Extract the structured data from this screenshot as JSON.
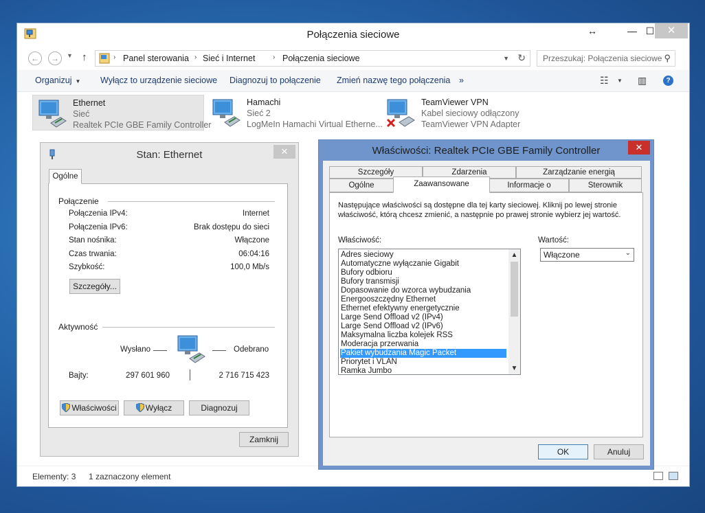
{
  "window": {
    "title": "Połączenia sieciowe",
    "caption": {
      "restore": "↔",
      "minimize": "—",
      "maximize": "☐",
      "close": "✕"
    }
  },
  "address": {
    "back_icon": "back-arrow-icon",
    "breadcrumbs": [
      "Panel sterowania",
      "Sieć i Internet",
      "Połączenia sieciowe"
    ],
    "search_placeholder": "Przeszukaj: Połączenia sieciowe"
  },
  "toolbar": {
    "organize": "Organizuj",
    "disable": "Wyłącz to urządzenie sieciowe",
    "diagnose": "Diagnozuj to połączenie",
    "rename": "Zmień nazwę tego połączenia",
    "more": "»"
  },
  "connections": [
    {
      "name": "Ethernet",
      "status": "Sieć",
      "device": "Realtek PCIe GBE Family Controller",
      "selected": true
    },
    {
      "name": "Hamachi",
      "status": "Sieć  2",
      "device": "LogMeIn Hamachi Virtual Etherne...",
      "selected": false
    },
    {
      "name": "TeamViewer VPN",
      "status": "Kabel sieciowy odłączony",
      "device": "TeamViewer VPN Adapter",
      "selected": false,
      "disconnected": true
    }
  ],
  "statusbar": {
    "count": "Elementy: 3",
    "selected": "1 zaznaczony element"
  },
  "status_dialog": {
    "title": "Stan: Ethernet",
    "tab": "Ogólne",
    "connection_group": "Połączenie",
    "rows": [
      {
        "label": "Połączenia IPv4:",
        "value": "Internet"
      },
      {
        "label": "Połączenia IPv6:",
        "value": "Brak dostępu do sieci"
      },
      {
        "label": "Stan nośnika:",
        "value": "Włączone"
      },
      {
        "label": "Czas trwania:",
        "value": "06:04:16"
      },
      {
        "label": "Szybkość:",
        "value": "100,0 Mb/s"
      }
    ],
    "details_button": "Szczegóły...",
    "activity_group": "Aktywność",
    "sent_label": "Wysłano",
    "received_label": "Odebrano",
    "bytes_label": "Bajty:",
    "bytes_sent": "297 601 960",
    "bytes_received": "2 716 715 423",
    "properties_button": "Właściwości",
    "disable_button": "Wyłącz",
    "diagnose_button": "Diagnozuj",
    "close_button": "Zamknij"
  },
  "props_dialog": {
    "title": "Właściwości: Realtek PCIe GBE Family Controller",
    "tabs_back": [
      "Szczegóły",
      "Zdarzenia",
      "Zarządzanie energią"
    ],
    "tabs_front": [
      "Ogólne",
      "Zaawansowane",
      "Informacje o",
      "Sterownik"
    ],
    "active_tab": "Zaawansowane",
    "description_line1": "Następujące właściwości są dostępne dla tej karty sieciowej. Kliknij po lewej stronie",
    "description_line2": "właściwość, którą chcesz zmienić, a następnie po prawej stronie wybierz jej wartość.",
    "property_label": "Właściwość:",
    "value_label": "Wartość:",
    "properties": [
      "Adres sieciowy",
      "Automatyczne wyłączanie Gigabit",
      "Bufory odbioru",
      "Bufory transmisji",
      "Dopasowanie do wzorca wybudzania",
      "Energooszczędny Ethernet",
      "Ethernet efektywny energetycznie",
      "Large Send Offload v2 (IPv4)",
      "Large Send Offload v2 (IPv6)",
      "Maksymalna liczba kolejek RSS",
      "Moderacja przerwania",
      "Pakiet wybudzania Magic Packet",
      "Priorytet i VLAN",
      "Ramka Jumbo"
    ],
    "selected_index": 11,
    "selected_value": "Włączone",
    "ok_button": "OK",
    "cancel_button": "Anuluj"
  }
}
